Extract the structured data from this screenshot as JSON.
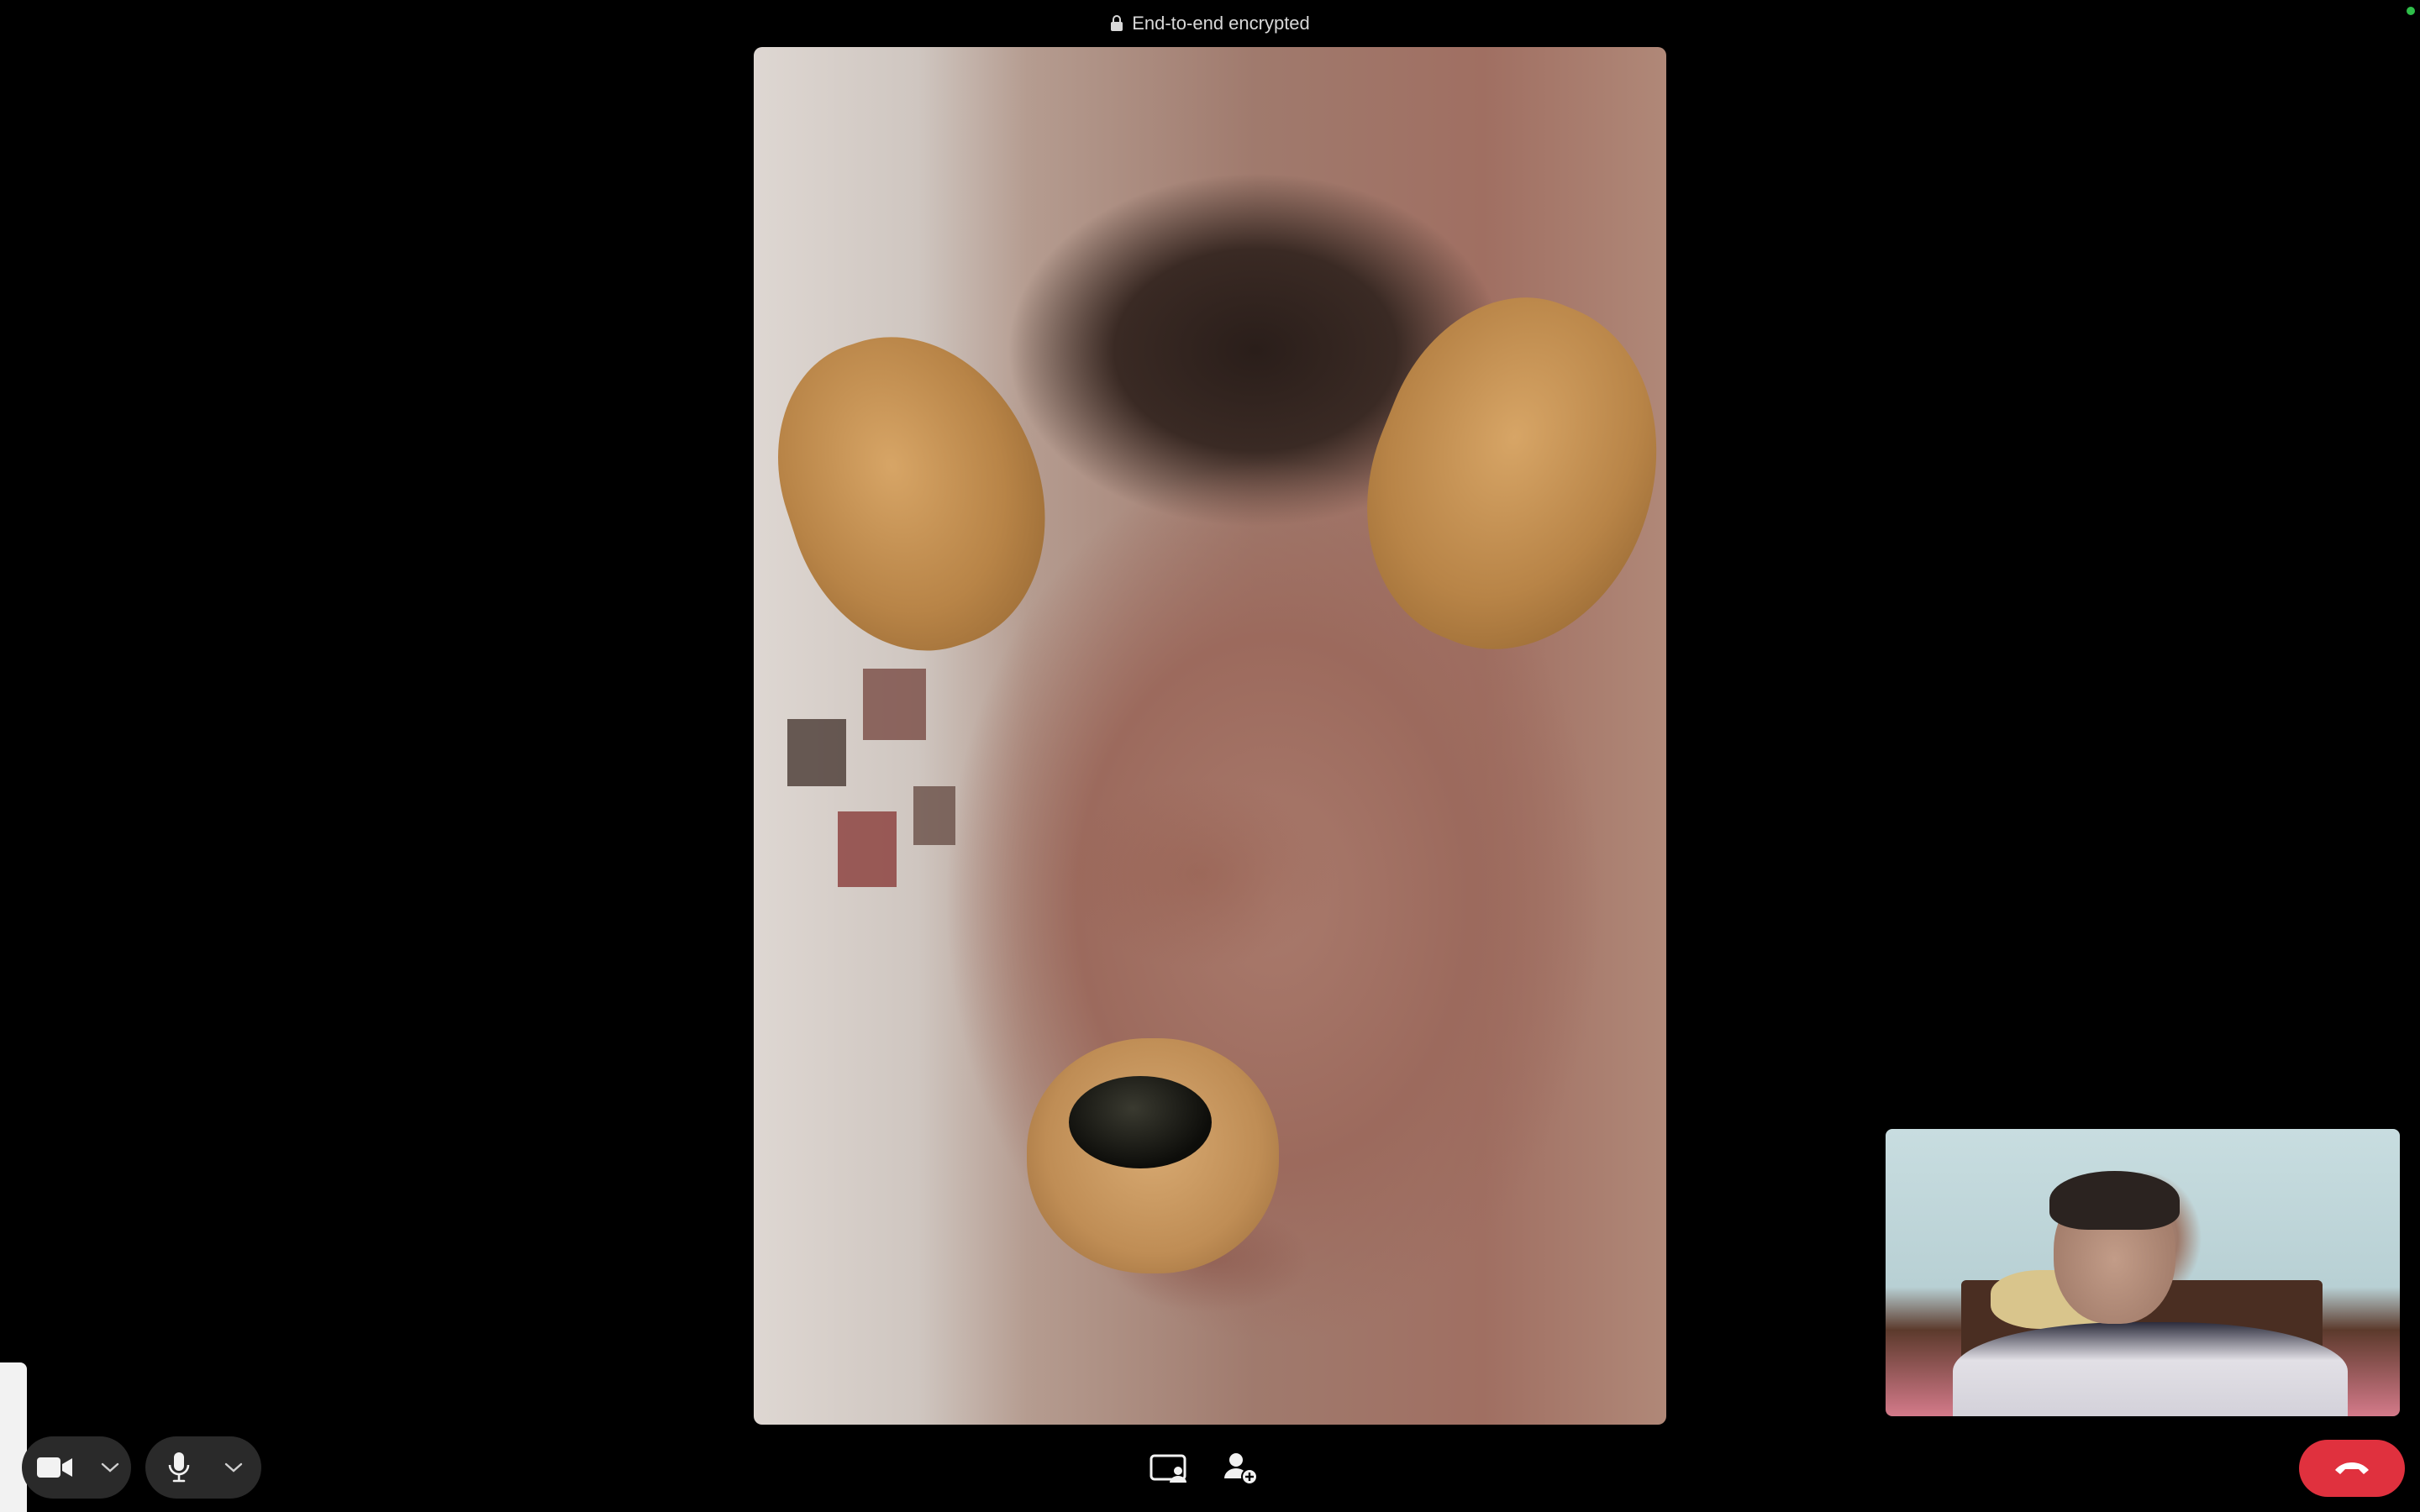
{
  "header": {
    "encryption_label": "End-to-end encrypted",
    "lock_icon": "lock-icon"
  },
  "status": {
    "indicator_color": "#2fbf4a"
  },
  "remote_participant": {
    "video_feed": "remote-video",
    "filter": "dog-ears-filter"
  },
  "self_view": {
    "video_feed": "self-video"
  },
  "controls": {
    "camera": {
      "icon": "video-camera-icon",
      "menu_icon": "chevron-down-icon"
    },
    "microphone": {
      "icon": "microphone-icon",
      "menu_icon": "chevron-down-icon"
    },
    "share_screen": {
      "icon": "screen-share-icon"
    },
    "add_participant": {
      "icon": "add-person-icon"
    },
    "end_call": {
      "icon": "phone-hangup-icon",
      "color": "#e0313e"
    }
  }
}
